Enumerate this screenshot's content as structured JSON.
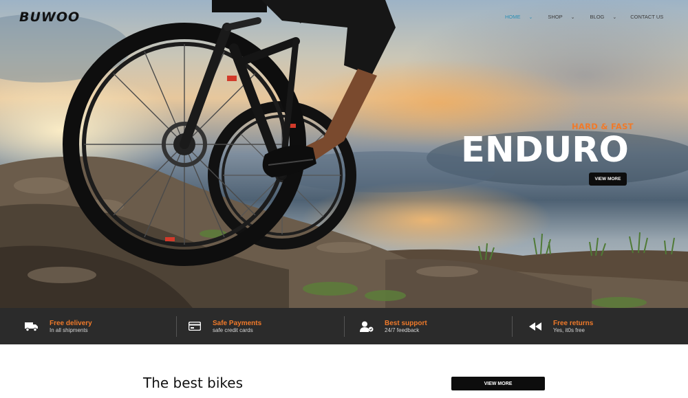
{
  "brand": {
    "logo": "BUWOO"
  },
  "nav": {
    "items": [
      {
        "label": "HOME",
        "chevron": "⌄"
      },
      {
        "label": "SHOP",
        "chevron": "⌄"
      },
      {
        "label": "BLOG",
        "chevron": "⌄"
      },
      {
        "label": "CONTACT US"
      }
    ],
    "active_color": "#2a8fb5"
  },
  "hero": {
    "tagline": "HARD & FAST",
    "title": "ENDURO",
    "button_label": "VIEW MORE",
    "accent_color": "#f07a2a"
  },
  "features": [
    {
      "icon": "truck-icon",
      "title": "Free delivery",
      "subtitle": "In all shipments"
    },
    {
      "icon": "credit-card-icon",
      "title": "Safe Payments",
      "subtitle": "safe credit cards"
    },
    {
      "icon": "support-user-icon",
      "title": "Best support",
      "subtitle": "24/7 feedback"
    },
    {
      "icon": "rewind-icon",
      "title": "Free returns",
      "subtitle": "Yes, it0s free"
    }
  ],
  "section": {
    "title": "The best bikes",
    "button_label": "VIEW MORE"
  }
}
